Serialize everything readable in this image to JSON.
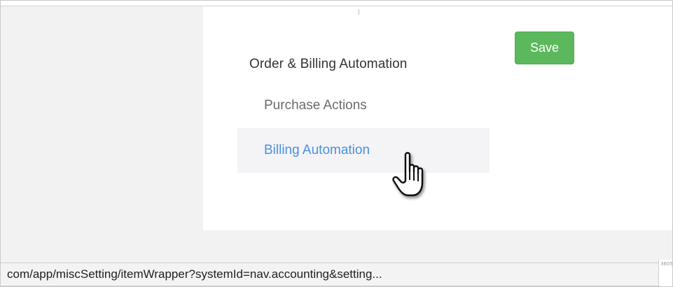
{
  "settings": {
    "section_heading": "Order & Billing Automation",
    "nav_items": [
      {
        "label": "Purchase Actions",
        "state": "default"
      },
      {
        "label": "Billing Automation",
        "state": "hover"
      }
    ],
    "save_label": "Save"
  },
  "status_bar": {
    "url": "com/app/miscSetting/itemWrapper?systemId=nav.accounting&setting...",
    "corner_text": "3605"
  },
  "colors": {
    "save_button": "#5cb85c",
    "link_hover": "#4a90e2",
    "text_muted": "#6b6b6b",
    "heading": "#333333"
  },
  "icons": {
    "cursor": "hand-pointer-icon"
  }
}
